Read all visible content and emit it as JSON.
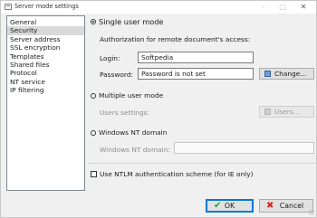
{
  "window": {
    "title": "Server mode settings",
    "minimize_glyph": "–",
    "maximize_glyph": "□",
    "close_glyph": "✕"
  },
  "sidebar": {
    "items": [
      {
        "label": "General",
        "selected": false
      },
      {
        "label": "Security",
        "selected": true
      },
      {
        "label": "Server address",
        "selected": false
      },
      {
        "label": "SSL encryption",
        "selected": false
      },
      {
        "label": "Templates",
        "selected": false
      },
      {
        "label": "Shared files",
        "selected": false
      },
      {
        "label": "Protocol",
        "selected": false
      },
      {
        "label": "NT service",
        "selected": false
      },
      {
        "label": "IP filtering",
        "selected": false
      }
    ]
  },
  "security": {
    "single_user": {
      "label": "Single user mode",
      "selected": true,
      "auth_caption": "Authorization for remote document's access:",
      "login_label": "Login:",
      "login_value": "Softpedia",
      "password_label": "Password:",
      "password_value": "Password is not set",
      "change_button": "Change..."
    },
    "multiple_user": {
      "label": "Multiple user mode",
      "selected": false,
      "users_label": "Users settings:",
      "users_button": "Users..."
    },
    "nt_domain": {
      "label": "Windows NT domain",
      "selected": false,
      "domain_label": "Windows NT domain:",
      "domain_value": ""
    },
    "ntlm": {
      "label": "Use NTLM authentication scheme (for IE only)",
      "checked": false
    }
  },
  "footer": {
    "ok_label": "OK",
    "ok_glyph": "✔",
    "cancel_label": "Cancel",
    "cancel_glyph": "✖"
  },
  "colors": {
    "accent": "#0078d7",
    "ok_icon": "#2e9e2e",
    "cancel_icon": "#d8221d",
    "selected_item": "#d9d9d9"
  }
}
